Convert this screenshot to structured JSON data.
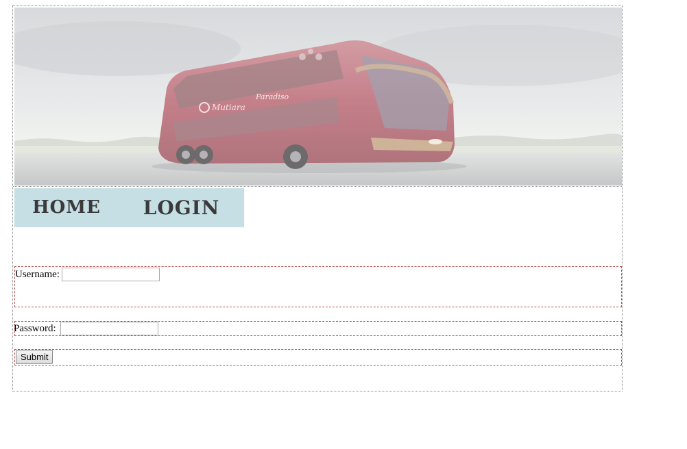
{
  "banner": {
    "image_name": "double-decker-bus-banner",
    "bus_brand_text": "Mutiara",
    "bus_model_text": "Paradiso"
  },
  "nav": {
    "items": [
      {
        "label": "HOME"
      },
      {
        "label": "LOGIN"
      }
    ],
    "background_color": "#c5dfe5"
  },
  "form": {
    "username_label": "Username:",
    "username_value": "",
    "password_label": "Password:",
    "password_value": "",
    "submit_label": "Submit"
  },
  "colors": {
    "row_border": "#b94a4a",
    "outer_border": "#888888"
  }
}
